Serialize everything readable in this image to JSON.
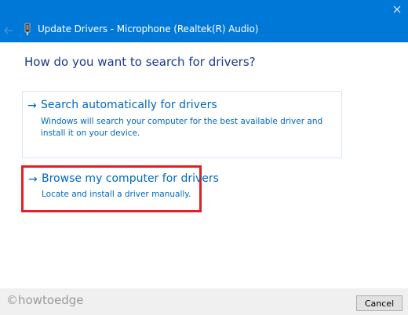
{
  "window": {
    "header_title": "Update Drivers - Microphone (Realtek(R) Audio)",
    "close_glyph": "✕",
    "accent_color": "#0078d7"
  },
  "main": {
    "heading": "How do you want to search for drivers?",
    "options": [
      {
        "arrow": "→",
        "title": "Search automatically for drivers",
        "description": "Windows will search your computer for the best available driver and install it on your device.",
        "highlighted": false
      },
      {
        "arrow": "→",
        "title": "Browse my computer for drivers",
        "description": "Locate and install a driver manually.",
        "highlighted": true,
        "highlight_color": "#e31e24"
      }
    ]
  },
  "footer": {
    "watermark": "©howtoedge",
    "cancel_label": "Cancel"
  },
  "icons": [
    "close-icon",
    "back-arrow-icon",
    "microphone-device-icon",
    "arrow-right-icon"
  ]
}
